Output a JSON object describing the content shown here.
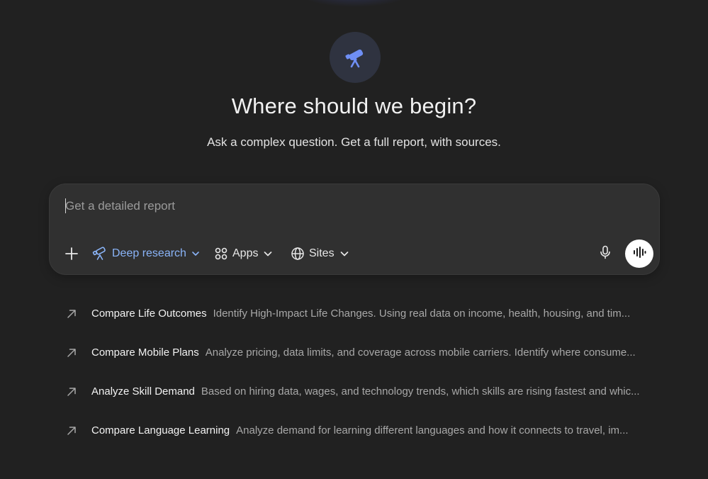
{
  "hero": {
    "icon": "telescope-icon",
    "accent_color": "#6f8ff5",
    "title": "Where should we begin?",
    "subtitle": "Ask a complex question. Get a full report, with sources."
  },
  "composer": {
    "placeholder": "Get a detailed report",
    "value": "",
    "tools": {
      "add_icon": "plus-icon",
      "deep_research_label": "Deep research",
      "deep_research_color": "#8ab4f8",
      "apps_label": "Apps",
      "sites_label": "Sites"
    },
    "mic_icon": "microphone-icon",
    "voice_icon": "voice-waveform-icon"
  },
  "suggestions": [
    {
      "title": "Compare Life Outcomes",
      "description": "Identify High-Impact Life Changes. Using real data on income, health, housing, and tim..."
    },
    {
      "title": "Compare Mobile Plans",
      "description": "Analyze pricing, data limits, and coverage across mobile carriers. Identify where consume..."
    },
    {
      "title": "Analyze Skill Demand",
      "description": "Based on hiring data, wages, and technology trends, which skills are rising fastest and whic..."
    },
    {
      "title": "Compare Language Learning",
      "description": "Analyze demand for learning different languages and how it connects to travel, im..."
    }
  ]
}
